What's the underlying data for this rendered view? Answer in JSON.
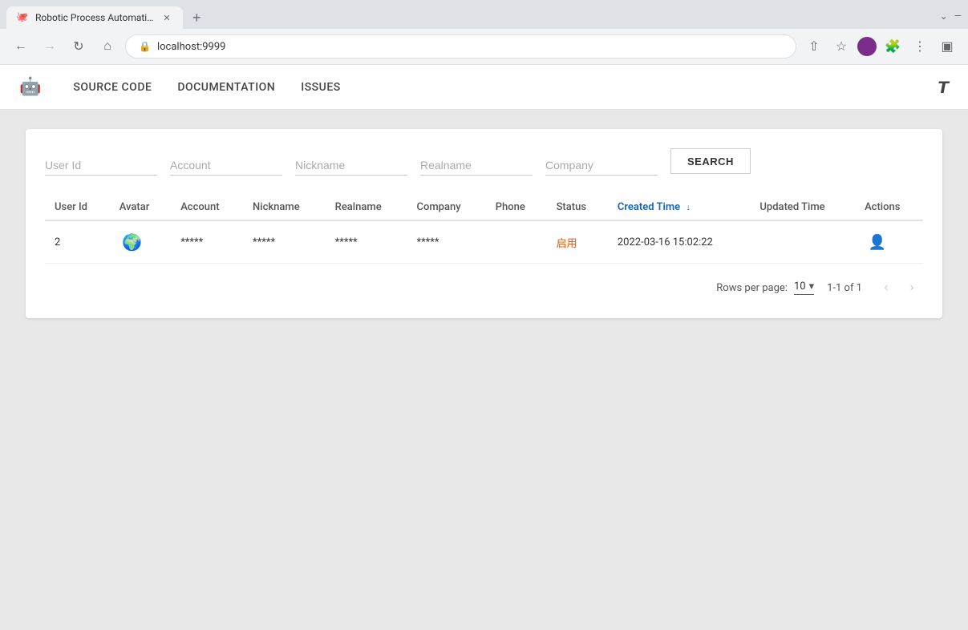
{
  "browser": {
    "tab_title": "Robotic Process Automation T",
    "url": "localhost:9999",
    "favicon": "🐙",
    "new_tab_label": "+",
    "nav": {
      "back_disabled": false,
      "forward_disabled": true
    }
  },
  "app": {
    "logo_icon": "🤖",
    "nav_links": [
      {
        "id": "source-code",
        "label": "SOURCE CODE"
      },
      {
        "id": "documentation",
        "label": "DOCUMENTATION"
      },
      {
        "id": "issues",
        "label": "ISSUES"
      }
    ],
    "translate_icon": "🌐"
  },
  "search_form": {
    "fields": [
      {
        "id": "user-id",
        "placeholder": "User Id",
        "value": ""
      },
      {
        "id": "account",
        "placeholder": "Account",
        "value": ""
      },
      {
        "id": "nickname",
        "placeholder": "Nickname",
        "value": ""
      },
      {
        "id": "realname",
        "placeholder": "Realname",
        "value": ""
      },
      {
        "id": "company",
        "placeholder": "Company",
        "value": ""
      }
    ],
    "search_button": "SEARCH"
  },
  "table": {
    "columns": [
      {
        "id": "user-id",
        "label": "User Id",
        "sorted": false
      },
      {
        "id": "avatar",
        "label": "Avatar",
        "sorted": false
      },
      {
        "id": "account",
        "label": "Account",
        "sorted": false
      },
      {
        "id": "nickname",
        "label": "Nickname",
        "sorted": false
      },
      {
        "id": "realname",
        "label": "Realname",
        "sorted": false
      },
      {
        "id": "company",
        "label": "Company",
        "sorted": false
      },
      {
        "id": "phone",
        "label": "Phone",
        "sorted": false
      },
      {
        "id": "status",
        "label": "Status",
        "sorted": false
      },
      {
        "id": "created-time",
        "label": "Created Time",
        "sorted": true,
        "sort_dir": "↓"
      },
      {
        "id": "updated-time",
        "label": "Updated Time",
        "sorted": false
      },
      {
        "id": "actions",
        "label": "Actions",
        "sorted": false
      }
    ],
    "rows": [
      {
        "user_id": "2",
        "avatar": "🌍",
        "account": "*****",
        "nickname": "*****",
        "realname": "*****",
        "company": "*****",
        "phone": "",
        "status": "启用",
        "created_time": "2022-03-16 15:02:22",
        "updated_time": ""
      }
    ]
  },
  "pagination": {
    "rows_per_page_label": "Rows per page:",
    "rows_per_page_value": "10",
    "page_info": "1-1 of 1",
    "prev_disabled": true,
    "next_disabled": true
  }
}
